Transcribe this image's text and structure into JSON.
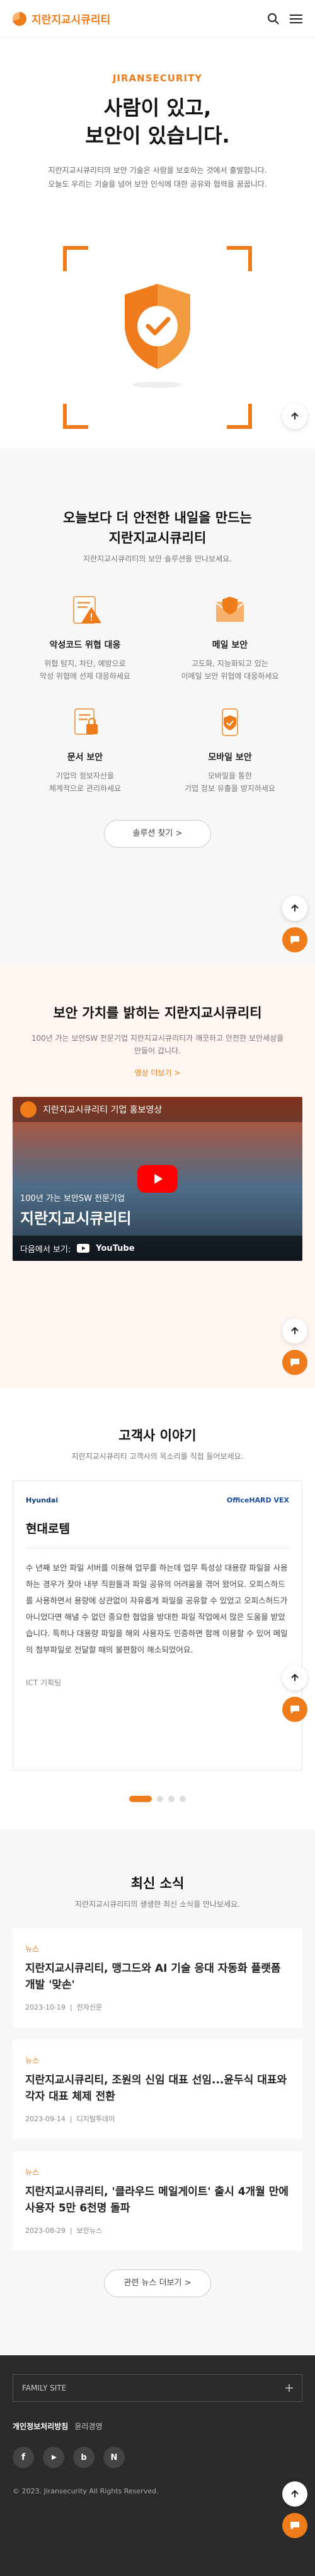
{
  "header": {
    "logo_text": "지란지교시큐리티"
  },
  "hero": {
    "eyebrow": "JIRANSECURITY",
    "title_l1": "사람이 있고,",
    "title_l2": "보안이 있습니다.",
    "desc_l1": "지란지교시큐리티의 보안 기술은 사람을 보호하는 것에서 출발합니다.",
    "desc_l2": "오늘도 우리는 기술을 넘어 보안 인식에 대한 공유와 협력을 꿈꿉니다."
  },
  "solutions": {
    "title": "오늘보다 더 안전한 내일을 만드는",
    "title2": "지란지교시큐리티",
    "subtitle": "지란지교시큐리티의 보안 솔루션을 만나보세요.",
    "items": [
      {
        "title": "악성코드 위협 대응",
        "d1": "위협 탐지, 차단, 예방으로",
        "d2": "악성 위협에 선제 대응하세요"
      },
      {
        "title": "메일 보안",
        "d1": "고도화, 지능화되고 있는",
        "d2": "이메일 보안 위협에 대응하세요"
      },
      {
        "title": "문서 보안",
        "d1": "기업의 정보자산을",
        "d2": "체계적으로 관리하세요"
      },
      {
        "title": "모바일 보안",
        "d1": "모바일을 통한",
        "d2": "기업 정보 유출을 방지하세요"
      }
    ],
    "button": "솔루션 찾기 >"
  },
  "value": {
    "title": "보안 가치를 밝히는 지란지교시큐리티",
    "d1": "100년 가는 보안SW 전문기업 지란지교시큐리티가 깨끗하고 안전한 보안세상을",
    "d2": "만들어 갑니다.",
    "link": "영상 더보기 >",
    "video_title": "지란지교시큐리티 기업 홍보영상",
    "video_overlay1": "100년 가는 보안SW 전문기업",
    "video_overlay2": "지란지교시큐리티",
    "video_watch": "다음에서 보기:",
    "video_platform": "YouTube"
  },
  "customers": {
    "title": "고객사 이야기",
    "subtitle": "지란지교시큐리티 고객사의 목소리를 직접 들어보세요.",
    "logo_left": "Hyundai",
    "logo_right": "OfficeHARD VEX",
    "company": "현대로템",
    "body": "수 년째 보안 파일 서버를 이용해 업무를 하는데 업무 특성상 대용량 파일을 사용하는 경우가 잦아 내부 직원들과 파일 공유의 어려움을 겪어 왔어요. 오피스하드를 사용하면서 용량에 상관없이 자유롭게 파일을 공유할 수 있었고 오피스허드가 아니었다면 해낼 수 없던 중요한 협업을 방대한 파일 작업에서 많은 도움을 받았습니다. 특히나 대용량 파일을 해외 사용자도 인증하면 함께 이용할 수 있어 메일의 첨부파일로 전달할 때의 불편함이 해소되었어요.",
    "author": "ICT 기획팀"
  },
  "news": {
    "title": "최신 소식",
    "subtitle": "지란지교시큐리티의 생생한 최신 소식을 만나보세요.",
    "items": [
      {
        "tag": "뉴스",
        "title": "지란지교시큐리티, 맹그드와 AI 기술 응대 자동화 플랫폼 개발 '맞손'",
        "date": "2023-10-19",
        "source": "전자신문"
      },
      {
        "tag": "뉴스",
        "title": "지란지교시큐리티, 조원의 신임 대표 선임...윤두식 대표와 각자 대표 체제 전환",
        "date": "2023-09-14",
        "source": "디지털투데이"
      },
      {
        "tag": "뉴스",
        "title": "지란지교시큐리티, '클라우드 메일게이트' 출시 4개월 만에 사용자 5만 6천명 돌파",
        "date": "2023-08-29",
        "source": "보안뉴스"
      }
    ],
    "button": "관련 뉴스 더보기 >"
  },
  "footer": {
    "family_site": "FAMILY SITE",
    "privacy": "개인정보처리방침",
    "email_policy": "윤리경영",
    "copyright": "© 2023. Jiransecurity All Rights Reserved."
  }
}
